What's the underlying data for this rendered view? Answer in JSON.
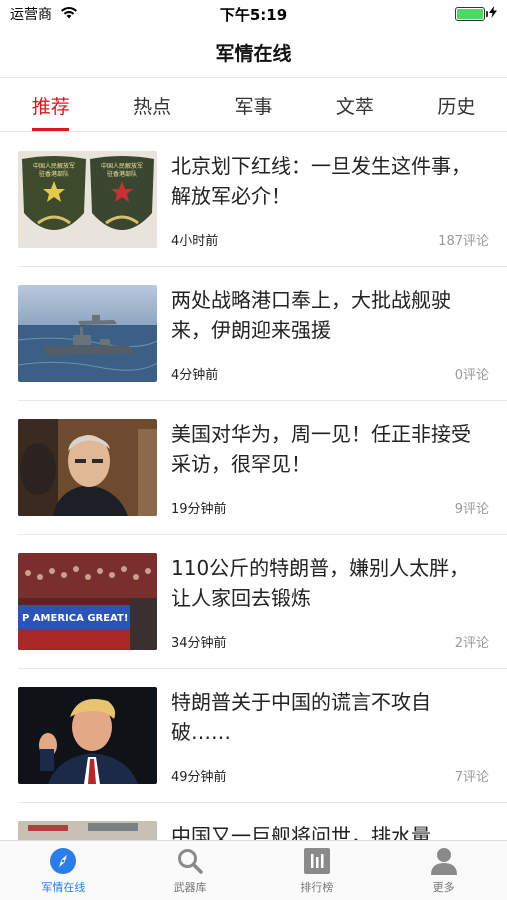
{
  "status": {
    "carrier": "运营商",
    "time": "下午5:19",
    "battery_fraction": 1.0
  },
  "header": {
    "title": "军情在线"
  },
  "tabs": [
    {
      "label": "推荐",
      "active": true
    },
    {
      "label": "热点",
      "active": false
    },
    {
      "label": "军事",
      "active": false
    },
    {
      "label": "文萃",
      "active": false
    },
    {
      "label": "历史",
      "active": false
    }
  ],
  "articles": [
    {
      "title": "北京划下红线：一旦发生这件事，解放军必介！",
      "time": "4小时前",
      "comments": "187评论",
      "badge_text_1": "中国人民解放军",
      "badge_text_2": "驻香港部队"
    },
    {
      "title": "两处战略港口奉上，大批战舰驶来，伊朗迎来强援",
      "time": "4分钟前",
      "comments": "0评论"
    },
    {
      "title": "美国对华为，周一见！任正非接受采访，很罕见！",
      "time": "19分钟前",
      "comments": "9评论"
    },
    {
      "title": "110公斤的特朗普，嫌别人太胖，让人家回去锻炼",
      "time": "34分钟前",
      "comments": "2评论",
      "banner_text": "P AMERICA GREAT!"
    },
    {
      "title": "特朗普关于中国的谎言不攻自破……",
      "time": "49分钟前",
      "comments": "7评论"
    },
    {
      "title": "中国又一巨舰将问世，排水量",
      "time": "",
      "comments": ""
    }
  ],
  "tabbar": [
    {
      "label": "军情在线",
      "icon": "compass-icon",
      "active": true
    },
    {
      "label": "武器库",
      "icon": "search-icon",
      "active": false
    },
    {
      "label": "排行榜",
      "icon": "chart-icon",
      "active": false
    },
    {
      "label": "更多",
      "icon": "user-icon",
      "active": false
    }
  ],
  "colors": {
    "accent_red": "#d71920",
    "accent_blue": "#2b7de9"
  }
}
